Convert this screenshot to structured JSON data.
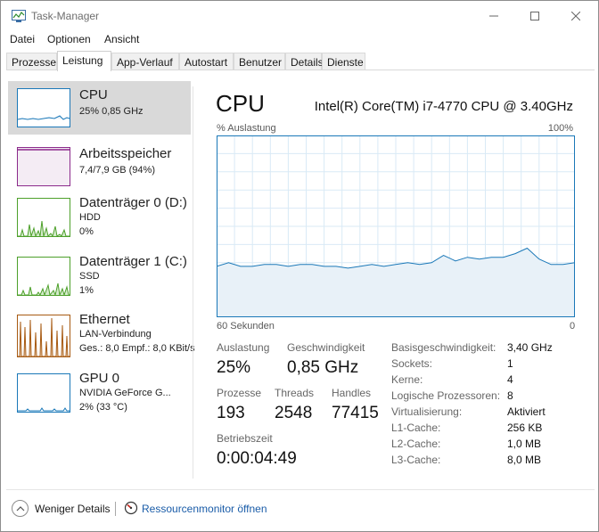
{
  "window": {
    "title": "Task-Manager"
  },
  "menu": [
    "Datei",
    "Optionen",
    "Ansicht"
  ],
  "tabs": [
    "Prozesse",
    "Leistung",
    "App-Verlauf",
    "Autostart",
    "Benutzer",
    "Details",
    "Dienste"
  ],
  "active_tab": "Leistung",
  "sidebar": {
    "items": [
      {
        "title": "CPU",
        "sub1": "25% 0,85 GHz",
        "color": "#1a78b8",
        "selected": true
      },
      {
        "title": "Arbeitsspeicher",
        "sub1": "7,4/7,9 GB (94%)",
        "color": "#8b2a8b"
      },
      {
        "title": "Datenträger 0 (D:)",
        "sub1": "HDD",
        "sub2": "0%",
        "color": "#4da02a"
      },
      {
        "title": "Datenträger 1 (C:)",
        "sub1": "SSD",
        "sub2": "1%",
        "color": "#4da02a"
      },
      {
        "title": "Ethernet",
        "sub1": "LAN-Verbindung",
        "sub2": "Ges.: 8,0  Empf.: 8,0 KBit/s",
        "color": "#a75a12"
      },
      {
        "title": "GPU 0",
        "sub1": "NVIDIA GeForce G...",
        "sub2": "2% (33 °C)",
        "color": "#1a78b8"
      }
    ]
  },
  "main": {
    "title": "CPU",
    "model": "Intel(R) Core(TM) i7-4770 CPU @ 3.40GHz",
    "y_label": "% Auslastung",
    "y_max": "100%",
    "x_left": "60 Sekunden",
    "x_right": "0",
    "accent": "#1a78b8",
    "stats": {
      "auslastung_label": "Auslastung",
      "auslastung": "25%",
      "geschwindigkeit_label": "Geschwindigkeit",
      "geschwindigkeit": "0,85 GHz",
      "prozesse_label": "Prozesse",
      "prozesse": "193",
      "threads_label": "Threads",
      "threads": "2548",
      "handles_label": "Handles",
      "handles": "77415",
      "betriebszeit_label": "Betriebszeit",
      "betriebszeit": "0:00:04:49"
    },
    "specs": [
      {
        "label": "Basisgeschwindigkeit:",
        "value": "3,40 GHz"
      },
      {
        "label": "Sockets:",
        "value": "1"
      },
      {
        "label": "Kerne:",
        "value": "4"
      },
      {
        "label": "Logische Prozessoren:",
        "value": "8"
      },
      {
        "label": "Virtualisierung:",
        "value": "Aktiviert"
      },
      {
        "label": "L1-Cache:",
        "value": "256 KB"
      },
      {
        "label": "L2-Cache:",
        "value": "1,0 MB"
      },
      {
        "label": "L3-Cache:",
        "value": "8,0 MB"
      }
    ]
  },
  "chart_data": {
    "type": "area",
    "xlabel": "60 Sekunden",
    "ylabel": "% Auslastung",
    "ylim": [
      0,
      100
    ],
    "x": [
      60,
      58,
      56,
      54,
      52,
      50,
      48,
      46,
      44,
      42,
      40,
      38,
      36,
      34,
      32,
      30,
      28,
      26,
      24,
      22,
      20,
      18,
      16,
      14,
      12,
      10,
      8,
      6,
      4,
      2,
      0
    ],
    "series": [
      {
        "values": [
          28,
          30,
          28,
          28,
          29,
          29,
          28,
          29,
          29,
          28,
          28,
          27,
          28,
          29,
          28,
          29,
          30,
          29,
          30,
          34,
          31,
          33,
          32,
          33,
          33,
          35,
          38,
          32,
          29,
          29,
          30
        ]
      }
    ]
  },
  "footer": {
    "fewer_details": "Weniger Details",
    "resource_monitor": "Ressourcenmonitor öffnen"
  }
}
